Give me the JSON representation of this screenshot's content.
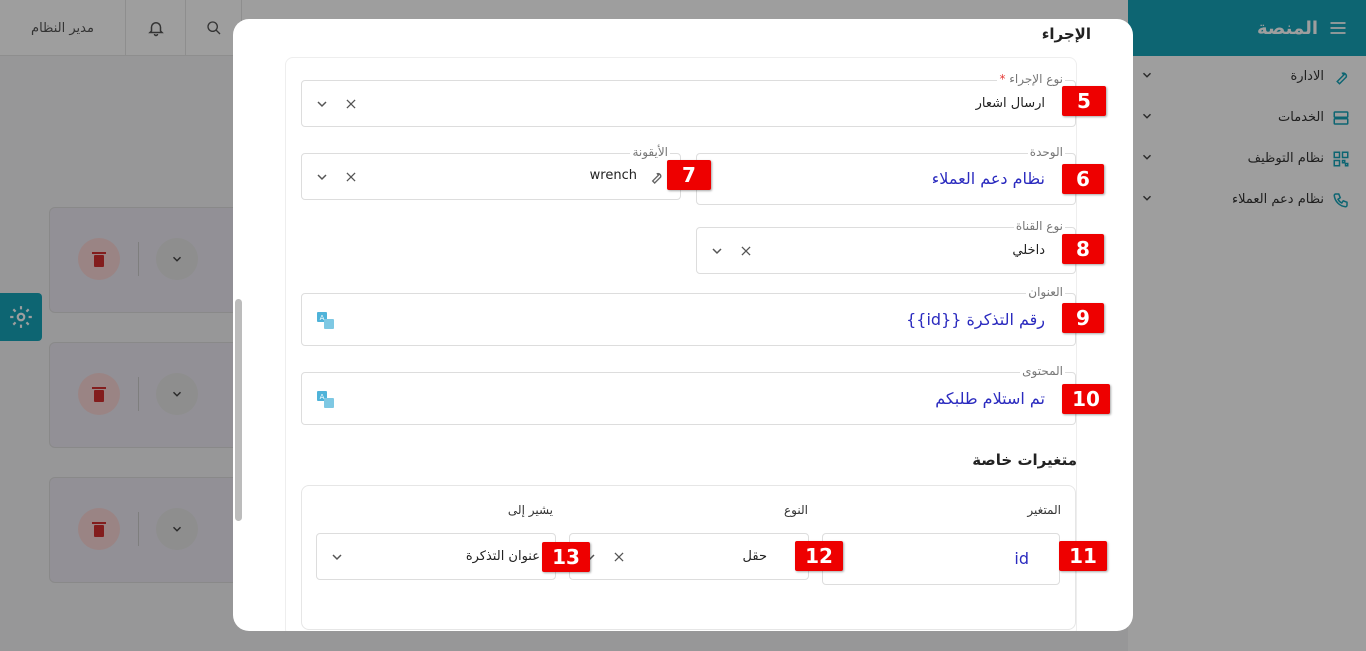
{
  "topbar": {
    "user_label": "مدير النظام"
  },
  "sidebar": {
    "brand": "المنصة",
    "items": [
      {
        "label": "الادارة",
        "icon": "wrench-icon"
      },
      {
        "label": "الخدمات",
        "icon": "server-icon"
      },
      {
        "label": "نظام التوظيف",
        "icon": "qr-icon"
      },
      {
        "label": "نظام دعم العملاء",
        "icon": "phone-icon"
      }
    ]
  },
  "modal": {
    "title": "الإجراء",
    "action_type": {
      "label": "نوع الإجراء",
      "required_mark": "*",
      "value": "ارسال اشعار",
      "marker": "5"
    },
    "unit": {
      "label": "الوحدة",
      "value": "نظام دعم العملاء",
      "marker": "6"
    },
    "icon_field": {
      "label": "الأيقونة",
      "value": "wrench",
      "marker": "7"
    },
    "channel_type": {
      "label": "نوع القناة",
      "value": "داخلي",
      "marker": "8"
    },
    "title_field": {
      "label": "العنوان",
      "value": "رقم التذكرة {{id}}",
      "marker": "9"
    },
    "content_field": {
      "label": "المحتوى",
      "value": "تم استلام طلبكم",
      "marker": "10"
    },
    "custom_vars": {
      "title": "متغيرات خاصة",
      "col_variable": "المتغير",
      "col_type": "النوع",
      "col_refers": "يشير إلى",
      "row": {
        "variable": "id",
        "variable_marker": "11",
        "type": "حقل",
        "type_marker": "12",
        "refers": "عنوان التذكرة",
        "refers_marker": "13"
      }
    }
  },
  "colors": {
    "accent": "#15a3b8",
    "marker": "#ee0000",
    "link_blue": "#2b2bbf"
  }
}
